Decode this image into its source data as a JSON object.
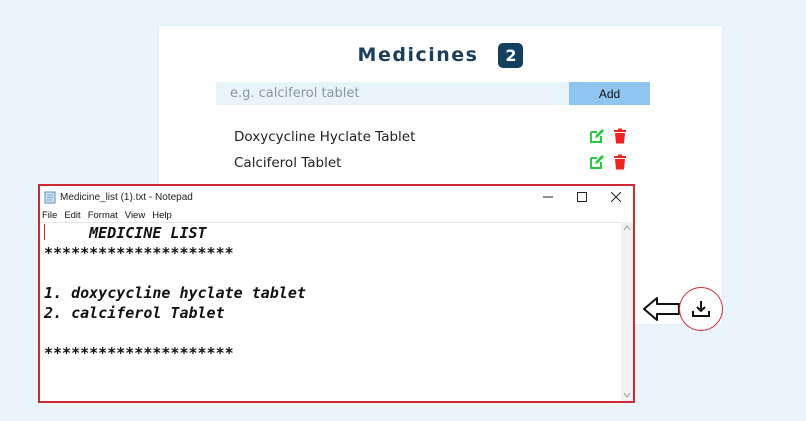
{
  "app": {
    "title": "Medicines",
    "count": "2",
    "input": {
      "placeholder": "e.g. calciferol tablet",
      "value": ""
    },
    "add_label": "Add",
    "items": [
      {
        "name": "Doxycycline Hyclate Tablet",
        "edit_icon": "edit-icon",
        "delete_icon": "trash-icon"
      },
      {
        "name": "Calciferol Tablet",
        "edit_icon": "edit-icon",
        "delete_icon": "trash-icon"
      }
    ],
    "download_icon": "download-icon",
    "arrow_icon": "left-arrow-icon"
  },
  "notepad": {
    "title": "Medicine_list (1).txt - Notepad",
    "menu": [
      "File",
      "Edit",
      "Format",
      "View",
      "Help"
    ],
    "lines": [
      "     MEDICINE LIST",
      "*********************",
      "",
      "1. doxycycline hyclate tablet",
      "2. calciferol Tablet",
      "",
      "*********************"
    ]
  },
  "colors": {
    "background": "#eaf4fb",
    "title": "#1b3d5e",
    "badge": "#143f5f",
    "add_button": "#8ec6f1",
    "input_bg": "#e9f3fa",
    "edit": "#27c93f",
    "delete": "#f0231e",
    "highlight_border": "#cf2a33"
  }
}
